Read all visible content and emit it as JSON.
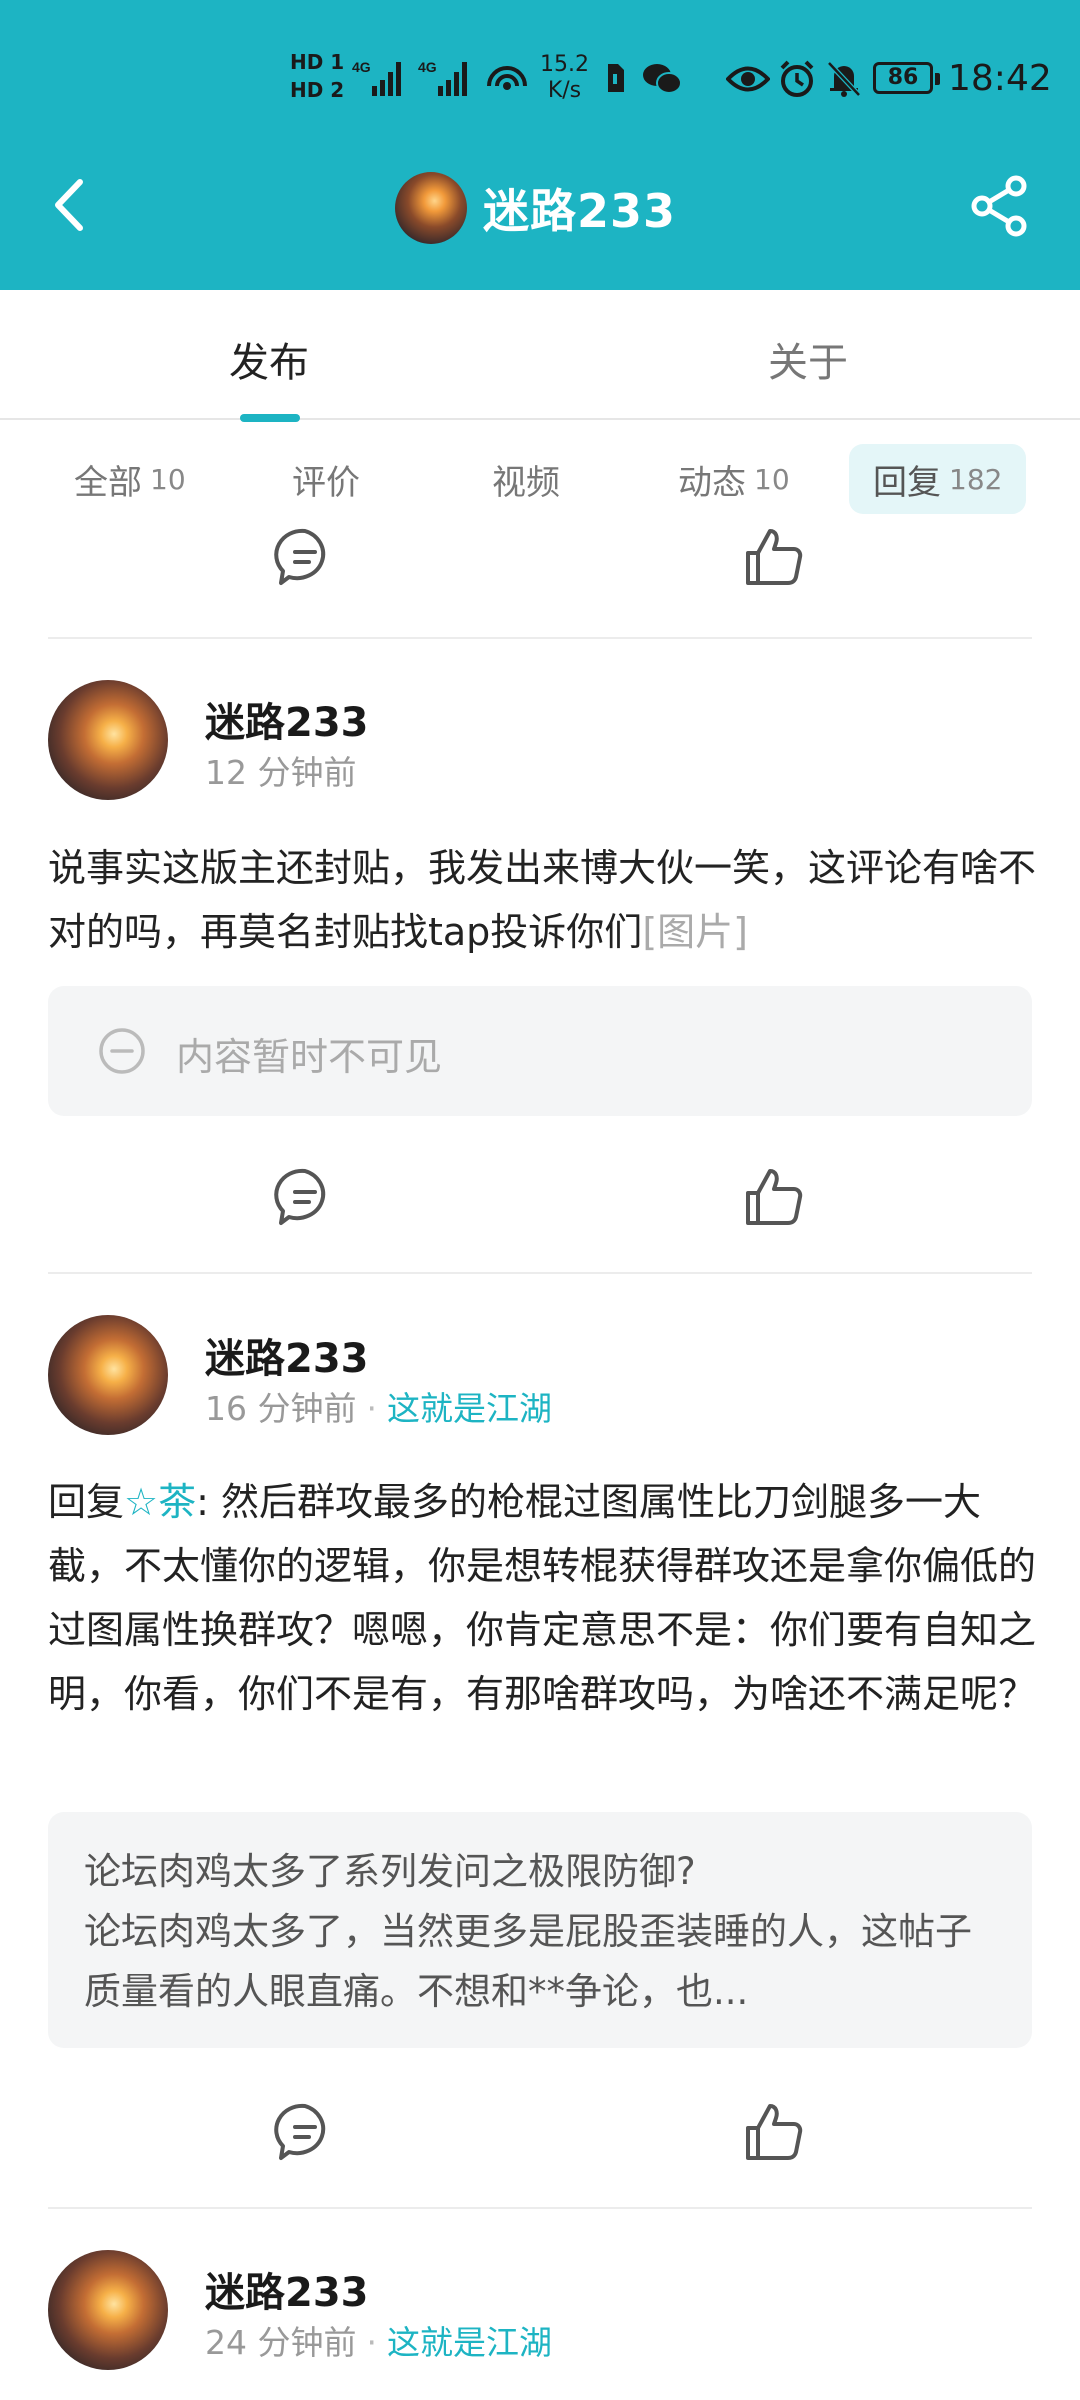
{
  "status_bar": {
    "hd1": "HD 1",
    "hd2": "HD 2",
    "signal1": "4G",
    "signal2": "4G",
    "speed_value": "15.2",
    "speed_unit": "K/s",
    "battery": "86",
    "time": "18:42"
  },
  "header": {
    "title": "迷路233"
  },
  "tabs": [
    {
      "label": "发布",
      "active": true
    },
    {
      "label": "关于",
      "active": false
    }
  ],
  "filters": [
    {
      "label": "全部",
      "count": "10"
    },
    {
      "label": "评价",
      "count": ""
    },
    {
      "label": "视频",
      "count": ""
    },
    {
      "label": "动态",
      "count": "10"
    },
    {
      "label": "回复",
      "count": "182",
      "active": true
    }
  ],
  "posts": [
    {
      "author": "迷路233",
      "time": "12 分钟前",
      "circle": "",
      "text": "说事实这版主还封贴，我发出来博大伙一笑，这评论有啥不对的吗，再莫名封贴找tap投诉你们",
      "image_tag": "[图片]",
      "hidden_notice": "内容暂时不可见"
    },
    {
      "author": "迷路233",
      "time": "16 分钟前",
      "circle": "这就是江湖",
      "reply_prefix": "回复",
      "reply_to": "☆茶",
      "text": ": 然后群攻最多的枪棍过图属性比刀剑腿多一大截，不太懂你的逻辑，你是想转棍获得群攻还是拿你偏低的过图属性换群攻？嗯嗯，你肯定意思不是：你们要有自知之明，你看，你们不是有，有那啥群攻吗，为啥还不满足呢？",
      "quote_title": "论坛肉鸡太多了系列发问之极限防御?",
      "quote_body": "论坛肉鸡太多了，当然更多是屁股歪装睡的人，这帖子质量看的人眼直痛。不想和**争论，也..."
    },
    {
      "author": "迷路233",
      "time": "24 分钟前",
      "circle": "这就是江湖"
    }
  ],
  "colors": {
    "accent": "#1db4c3",
    "header_bg": "#1db4c3",
    "chip_active_bg": "#e4f6f8",
    "card_bg": "#f4f5f6"
  }
}
